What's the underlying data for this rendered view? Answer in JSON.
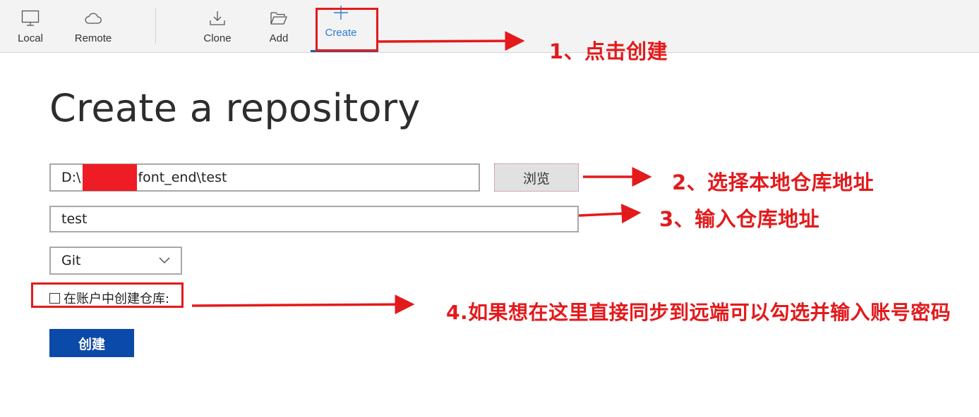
{
  "toolbar": {
    "local": "Local",
    "remote": "Remote",
    "clone": "Clone",
    "add": "Add",
    "create": "Create"
  },
  "page": {
    "title": "Create a repository"
  },
  "form": {
    "path_prefix": "D:\\",
    "path_suffix": "font_end\\test",
    "browse_label": "浏览",
    "name_value": "test",
    "vcs_selected": "Git",
    "checkbox_label": "在账户中创建仓库:",
    "create_label": "创建"
  },
  "annotations": {
    "step1": "1、点击创建",
    "step2": "2、选择本地仓库地址",
    "step3": "3、输入仓库地址",
    "step4": "4.如果想在这里直接同步到远端可以勾选并输入账号密码"
  },
  "colors": {
    "annotation_red": "#e31a1c",
    "accent_blue": "#2b7cd3",
    "primary_button": "#0b4aa8",
    "redaction": "#ee1c24"
  },
  "icons": [
    "monitor-icon",
    "cloud-icon",
    "download-icon",
    "folder-open-icon",
    "plus-icon",
    "chevron-down-icon"
  ]
}
